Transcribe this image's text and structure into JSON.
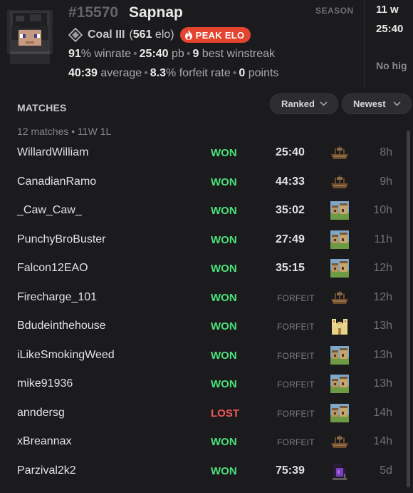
{
  "player": {
    "id": "#15570",
    "name": "Sapnap",
    "rank": "Coal III",
    "elo_open": "(",
    "elo_value": "561",
    "elo_suffix": " elo)",
    "peak_label": "PEAK ELO",
    "winrate": "91",
    "winrate_suffix": "% winrate",
    "pb_time": "25:40",
    "pb_suffix": " pb",
    "winstreak": "9",
    "winstreak_suffix": " best winstreak",
    "average": "40:39",
    "average_suffix": " average",
    "forfeit_rate": "8.3",
    "forfeit_suffix": "% forfeit rate",
    "points": "0",
    "points_suffix": " points",
    "season_label": "SEASON"
  },
  "season_panel": {
    "wins_fragment": "11 w",
    "pb_fragment": "25:40",
    "note_fragment": "No hig"
  },
  "matches": {
    "heading": "MATCHES",
    "filter_type": "Ranked",
    "sort": "Newest",
    "summary": "12 matches • 11W 1L",
    "rows": [
      {
        "opponent": "WillardWilliam",
        "result": "WON",
        "time": "25:40",
        "seed": "shipwreck",
        "ago": "8h"
      },
      {
        "opponent": "CanadianRamo",
        "result": "WON",
        "time": "44:33",
        "seed": "shipwreck",
        "ago": "9h"
      },
      {
        "opponent": "_Caw_Caw_",
        "result": "WON",
        "time": "35:02",
        "seed": "village",
        "ago": "10h"
      },
      {
        "opponent": "PunchyBroBuster",
        "result": "WON",
        "time": "27:49",
        "seed": "village",
        "ago": "11h"
      },
      {
        "opponent": "Falcon12EAO",
        "result": "WON",
        "time": "35:15",
        "seed": "village",
        "ago": "12h"
      },
      {
        "opponent": "Firecharge_101",
        "result": "WON",
        "time": "FORFEIT",
        "seed": "shipwreck",
        "ago": "12h"
      },
      {
        "opponent": "Bdudeinthehouse",
        "result": "WON",
        "time": "FORFEIT",
        "seed": "desert-temple",
        "ago": "13h"
      },
      {
        "opponent": "iLikeSmokingWeed",
        "result": "WON",
        "time": "FORFEIT",
        "seed": "village",
        "ago": "13h"
      },
      {
        "opponent": "mike91936",
        "result": "WON",
        "time": "FORFEIT",
        "seed": "village",
        "ago": "13h"
      },
      {
        "opponent": "anndersg",
        "result": "LOST",
        "time": "FORFEIT",
        "seed": "village",
        "ago": "14h"
      },
      {
        "opponent": "xBreannax",
        "result": "WON",
        "time": "FORFEIT",
        "seed": "shipwreck",
        "ago": "14h"
      },
      {
        "opponent": "Parzival2k2",
        "result": "WON",
        "time": "75:39",
        "seed": "ruined-portal",
        "ago": "5d"
      }
    ]
  },
  "colors": {
    "background": "#1b1b1d",
    "won": "#4be07b",
    "lost": "#f1595a",
    "peak_badge": "#e2442f"
  }
}
